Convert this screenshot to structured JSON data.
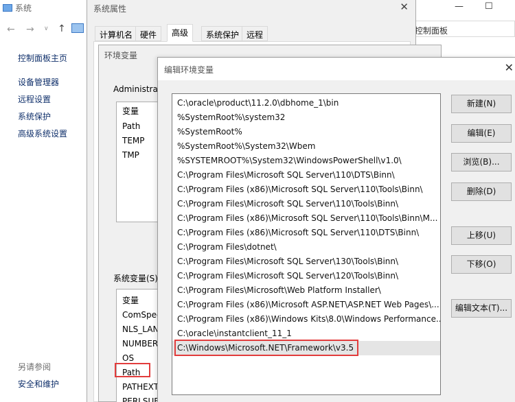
{
  "system_window": {
    "title": "系统",
    "address_text": "控制面板",
    "sidebar": {
      "home": "控制面板主页",
      "items": [
        "设备管理器",
        "远程设置",
        "系统保护",
        "高级系统设置"
      ],
      "see_also": "另请参阅",
      "security": "安全和维护"
    }
  },
  "sys_props": {
    "title": "系统属性",
    "tabs": [
      "计算机名",
      "硬件",
      "高级",
      "系统保护",
      "远程"
    ],
    "active_tab": "高级"
  },
  "env_vars": {
    "title": "环境变量",
    "user_label": "Administrat",
    "user_header": "变量",
    "user_rows": [
      "Path",
      "TEMP",
      "TMP"
    ],
    "sys_label": "系统变量(S)",
    "sys_header": "变量",
    "sys_rows": [
      "ComSpec",
      "NLS_LANG",
      "NUMBER_",
      "OS",
      "Path",
      "PATHEXT",
      "PERLSUB"
    ]
  },
  "edit_env": {
    "title": "编辑环境变量",
    "paths": [
      "C:\\oracle\\product\\11.2.0\\dbhome_1\\bin",
      "%SystemRoot%\\system32",
      "%SystemRoot%",
      "%SystemRoot%\\System32\\Wbem",
      "%SYSTEMROOT%\\System32\\WindowsPowerShell\\v1.0\\",
      "C:\\Program Files\\Microsoft SQL Server\\110\\DTS\\Binn\\",
      "C:\\Program Files (x86)\\Microsoft SQL Server\\110\\Tools\\Binn\\",
      "C:\\Program Files\\Microsoft SQL Server\\110\\Tools\\Binn\\",
      "C:\\Program Files (x86)\\Microsoft SQL Server\\110\\Tools\\Binn\\M...",
      "C:\\Program Files (x86)\\Microsoft SQL Server\\110\\DTS\\Binn\\",
      "C:\\Program Files\\dotnet\\",
      "C:\\Program Files\\Microsoft SQL Server\\130\\Tools\\Binn\\",
      "C:\\Program Files\\Microsoft SQL Server\\120\\Tools\\Binn\\",
      "C:\\Program Files\\Microsoft\\Web Platform Installer\\",
      "C:\\Program Files (x86)\\Microsoft ASP.NET\\ASP.NET Web Pages\\...",
      "C:\\Program Files (x86)\\Windows Kits\\8.0\\Windows Performance...",
      "C:\\oracle\\instantclient_11_1",
      "C:\\Windows\\Microsoft.NET\\Framework\\v3.5"
    ],
    "buttons": {
      "new": "新建(N)",
      "edit": "编辑(E)",
      "browse": "浏览(B)...",
      "delete": "删除(D)",
      "move_up": "上移(U)",
      "move_down": "下移(O)",
      "edit_text": "编辑文本(T)..."
    }
  },
  "colors": {
    "highlight_border": "#e23c3c",
    "dialog_bg": "#f0f0f0"
  }
}
